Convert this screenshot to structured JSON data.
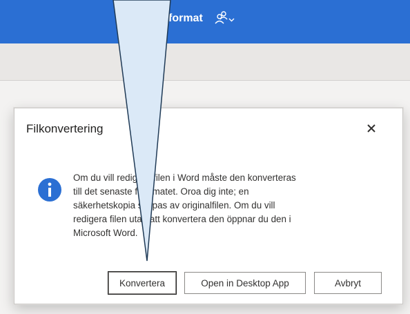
{
  "header": {
    "title_fragment": "format",
    "account_icon": "person-add-icon",
    "caret_icon": "chevron-down-icon",
    "accent_color": "#2b6fd3"
  },
  "dialog": {
    "title": "Filkonvertering",
    "close_icon": "close-icon",
    "info_icon": "info-icon",
    "message_lines": [
      "Om du vill redigera filen i Word måste den konverteras",
      "till det senaste filformatet. Oroa dig inte; en",
      "säkerhetskopia skapas av originalfilen. Om du vill",
      "redigera filen utan att konvertera den öppnar du den i",
      "Microsoft Word."
    ],
    "buttons": {
      "convert": "Konvertera",
      "open_desktop": "Open in Desktop App",
      "cancel": "Avbryt"
    }
  },
  "overlay": {
    "callout_color": "#dbe9f7",
    "callout_stroke": "#1f3a56"
  }
}
